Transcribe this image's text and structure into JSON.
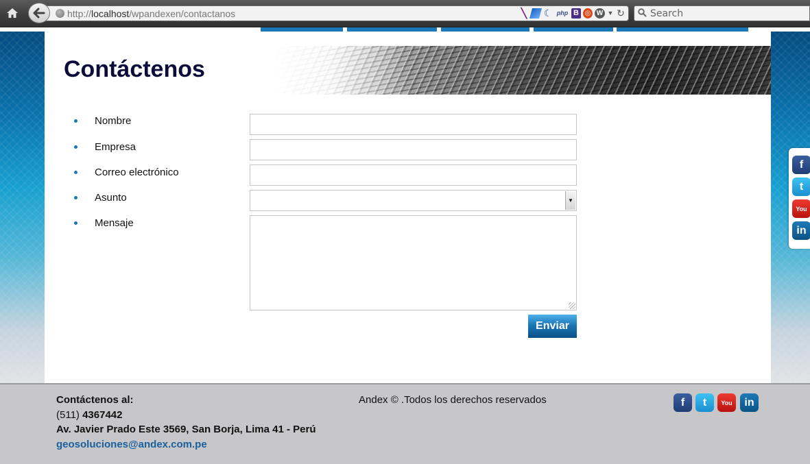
{
  "browser": {
    "url_protocol": "http://",
    "url_host": "localhost",
    "url_path": "/wpandexen/contactanos",
    "search_placeholder": "Search",
    "addon_php": "php",
    "addon_bootstrap": "B",
    "addon_wp": "W"
  },
  "page": {
    "title": "Contáctenos"
  },
  "form": {
    "fields": [
      {
        "label": "Nombre"
      },
      {
        "label": "Empresa"
      },
      {
        "label": "Correo electrónico"
      },
      {
        "label": "Asunto",
        "value": ""
      },
      {
        "label": "Mensaje"
      }
    ],
    "submit_label": "Enviar"
  },
  "social": {
    "facebook": "f",
    "twitter": "t",
    "youtube": "You",
    "linkedin": "in"
  },
  "footer": {
    "heading": "Contáctenos al:",
    "phone_prefix": "(511)",
    "phone_number": "4367442",
    "address": "Av. Javier Prado Este 3569, San Borja, Lima 41 - Perú",
    "email": "geosoluciones@andex.com.pe",
    "copyright": "Andex © .Todos los derechos reservados"
  },
  "colors": {
    "accent": "#1a78b6",
    "title": "#0c0c3a",
    "footer_bg": "#c7c7c9",
    "email_link": "#1a5f9e"
  }
}
